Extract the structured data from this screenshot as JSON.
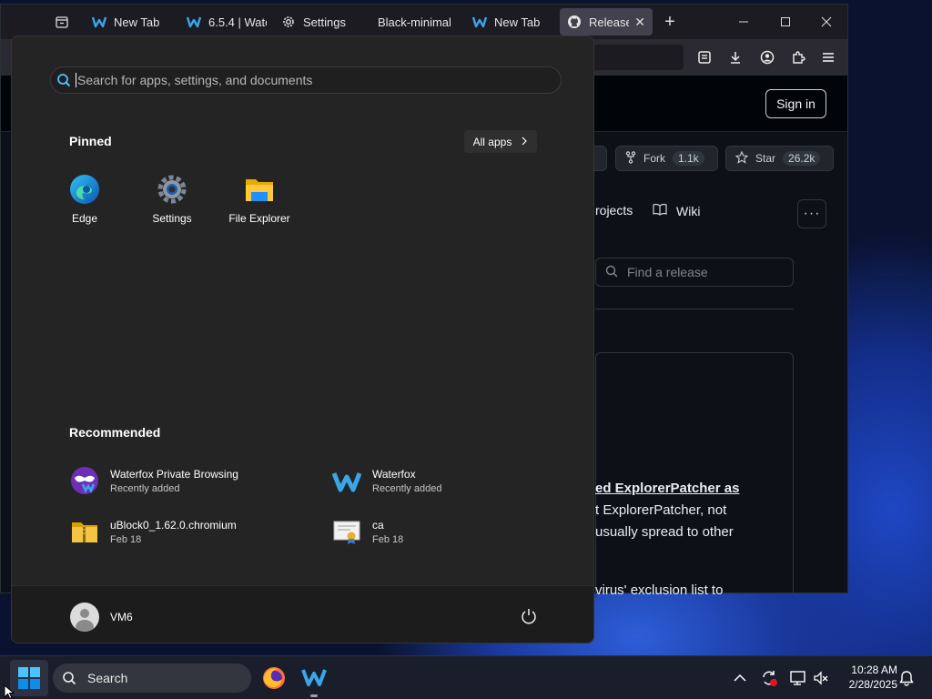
{
  "browser": {
    "tabs": [
      {
        "label": "New Tab",
        "icon": "waterfox-icon"
      },
      {
        "label": "6.5.4 | Wate",
        "icon": "waterfox-icon"
      },
      {
        "label": "Settings",
        "icon": "gear-icon"
      },
      {
        "label": "Black-minimal",
        "icon": ""
      },
      {
        "label": "New Tab",
        "icon": "waterfox-icon"
      },
      {
        "label": "Release",
        "icon": "github-icon"
      }
    ],
    "new_tab_symbol": "+",
    "github": {
      "sign_in": "Sign in",
      "fork_label": "Fork",
      "fork_count": "1.1k",
      "star_label": "Star",
      "star_count": "26.2k",
      "nav_projects": "rojects",
      "nav_wiki": "Wiki",
      "find_placeholder": "Find a release",
      "content_lines": [
        "ed ExplorerPatcher as",
        "t ExplorerPatcher, not",
        "usually spread to other",
        "virus' exclusion list to"
      ]
    }
  },
  "start_menu": {
    "search_placeholder": "Search for apps, settings, and documents",
    "pinned_title": "Pinned",
    "all_apps": "All apps",
    "pinned": [
      {
        "label": "Edge",
        "icon": "edge-icon"
      },
      {
        "label": "Settings",
        "icon": "settings-icon"
      },
      {
        "label": "File Explorer",
        "icon": "file-explorer-icon"
      }
    ],
    "recommended_title": "Recommended",
    "recommended": [
      {
        "name": "Waterfox Private Browsing",
        "sub": "Recently added",
        "icon": "waterfox-private-icon"
      },
      {
        "name": "Waterfox",
        "sub": "Recently added",
        "icon": "waterfox-icon"
      },
      {
        "name": "uBlock0_1.62.0.chromium",
        "sub": "Feb 18",
        "icon": "zip-folder-icon"
      },
      {
        "name": "ca",
        "sub": "Feb 18",
        "icon": "certificate-icon"
      }
    ],
    "user": "VM6"
  },
  "taskbar": {
    "search": "Search",
    "time": "10:28 AM",
    "date": "2/28/2025"
  },
  "colors": {
    "start_bg": "#242424",
    "accent": "#0078d4",
    "github_bg": "#0d1117"
  }
}
